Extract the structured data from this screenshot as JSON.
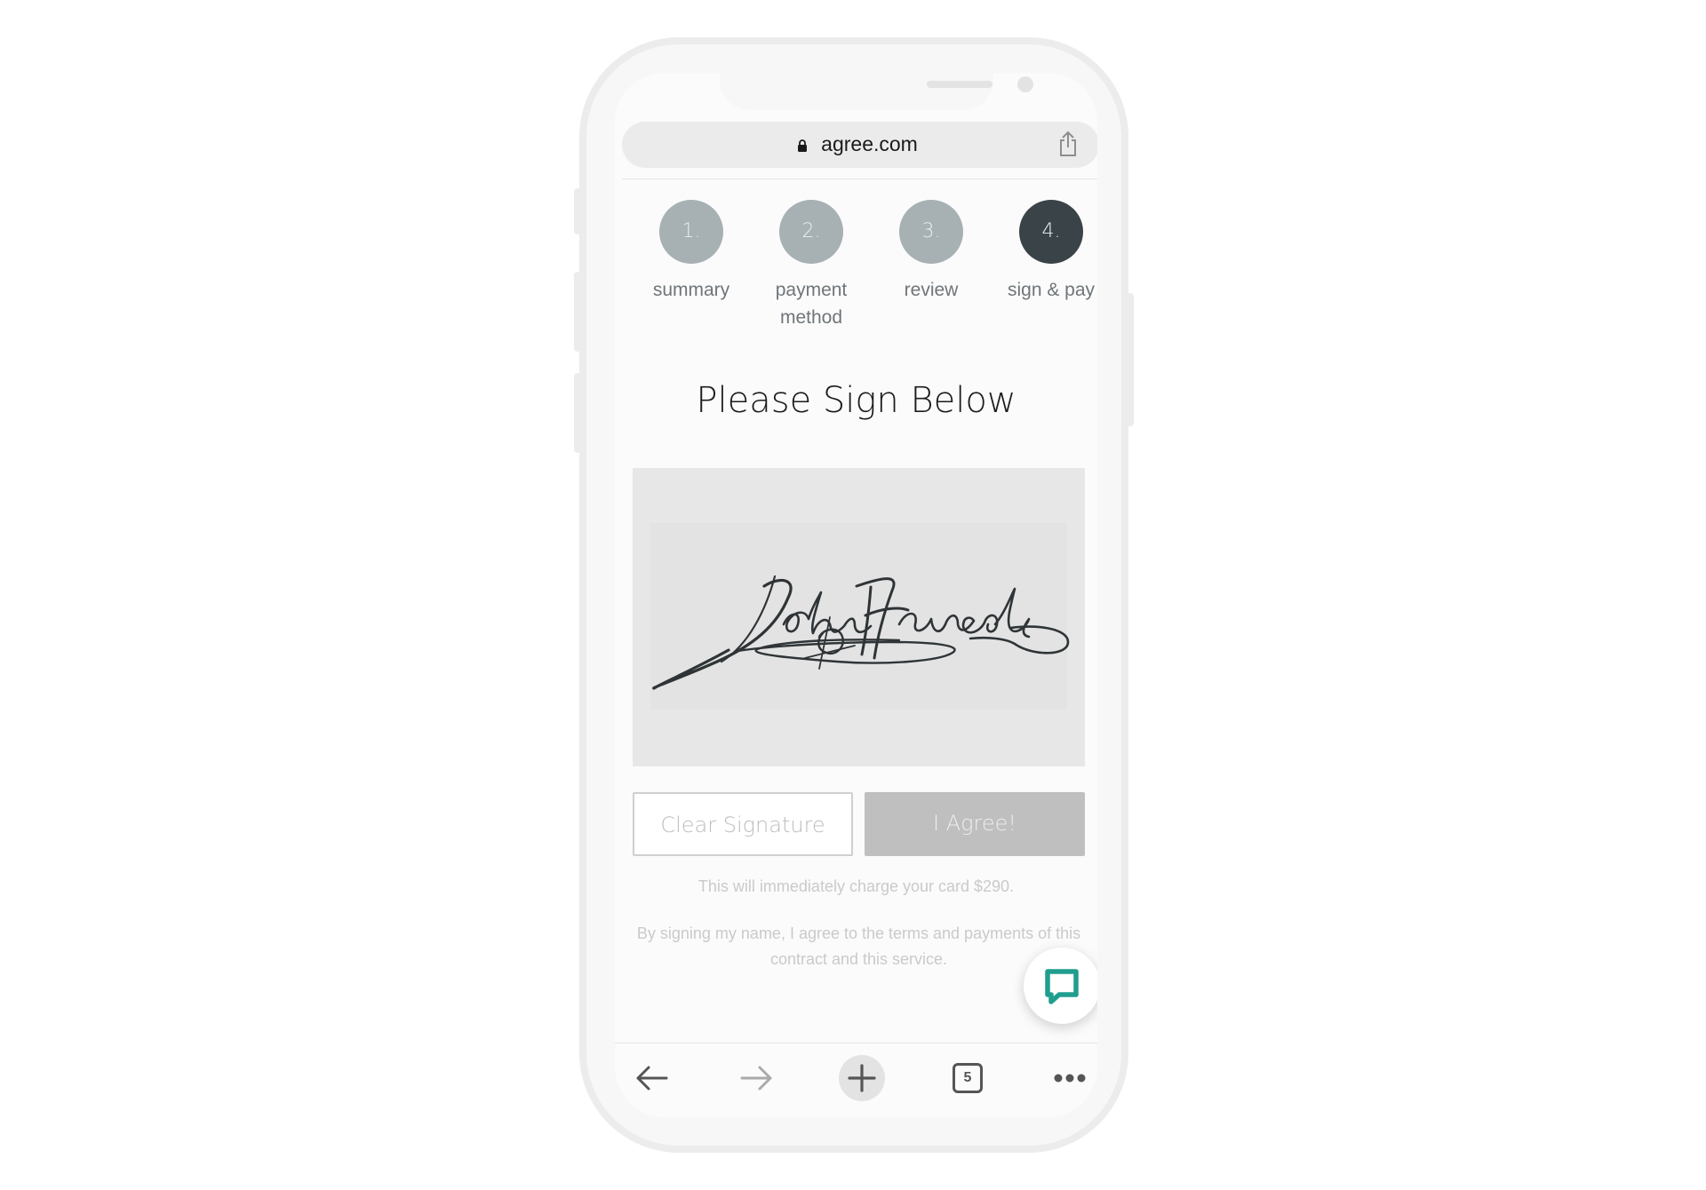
{
  "browser": {
    "url": "agree.com",
    "icons": {
      "lock": "lock-icon",
      "share": "share-icon"
    }
  },
  "steps": [
    {
      "number": "1.",
      "label": "summary",
      "active": false
    },
    {
      "number": "2.",
      "label": "payment method",
      "active": false
    },
    {
      "number": "3.",
      "label": "review",
      "active": false
    },
    {
      "number": "4.",
      "label": "sign & pay",
      "active": true
    }
  ],
  "main": {
    "heading": "Please Sign Below",
    "signature_text": "John Hancock",
    "clear_button": "Clear Signature",
    "agree_button": "I Agree!",
    "charge_notice": "This will immediately charge your card $290.",
    "terms_notice": "By signing my name, I agree to the terms and payments of this contract and this service."
  },
  "chat": {
    "icon": "chat-bubble-icon"
  },
  "toolbar": {
    "tabs_count": "5",
    "icons": [
      "back-arrow-icon",
      "forward-arrow-icon",
      "new-tab-plus-icon",
      "tabs-icon",
      "more-dots-icon"
    ]
  },
  "colors": {
    "step_inactive": "#a7b0b3",
    "step_active": "#3a4348",
    "accent_chat": "#1f9e8e",
    "button_disabled": "#bfbfbf"
  }
}
